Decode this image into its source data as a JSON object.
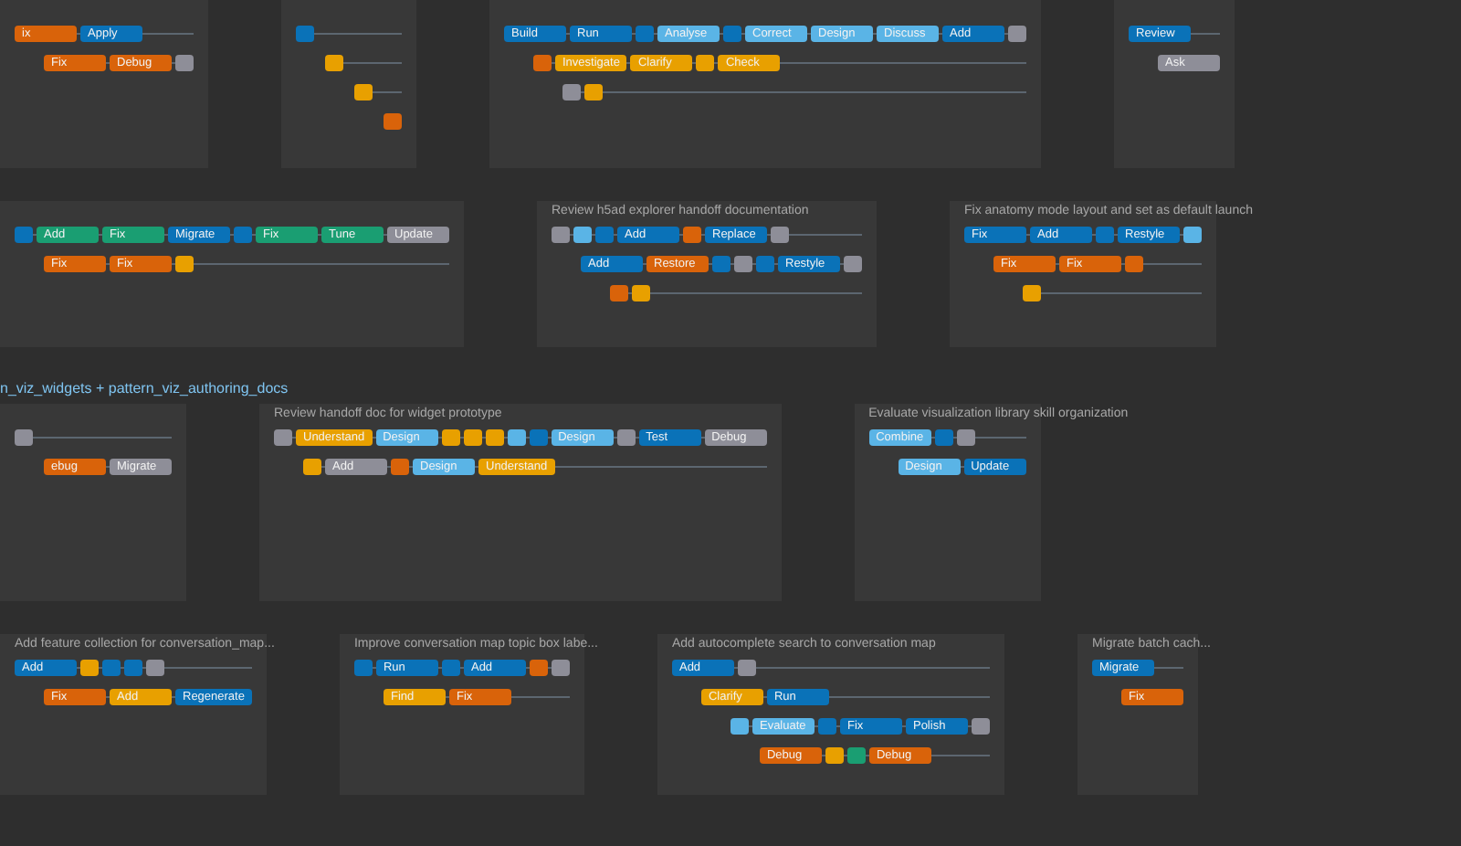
{
  "bands": [
    {
      "panels": [
        {
          "lanes": [
            {
              "nodes": [
                {
                  "label": "ix",
                  "color": "#d9630a"
                },
                {
                  "label": "Apply",
                  "color": "#0a72b8"
                }
              ]
            },
            {
              "nodes": [
                {
                  "label": "Fix",
                  "color": "#d9630a"
                },
                {
                  "label": "Debug",
                  "color": "#d9630a"
                },
                {
                  "color": "#8e8e98"
                }
              ]
            }
          ]
        },
        {
          "lanes": [
            {
              "nodes": [
                {
                  "color": "#0a72b8"
                }
              ]
            },
            {
              "nodes": [
                {
                  "color": "#e8a000"
                }
              ]
            },
            {
              "nodes": [
                {
                  "color": "#e8a000"
                }
              ]
            },
            {
              "nodes": [
                {
                  "color": "#d9630a"
                }
              ]
            }
          ]
        },
        {
          "lanes": [
            {
              "nodes": [
                {
                  "label": "Build",
                  "color": "#0a72b8"
                },
                {
                  "label": "Run",
                  "color": "#0a72b8"
                },
                {
                  "color": "#0a72b8"
                },
                {
                  "label": "Analyse",
                  "color": "#5ab4e6"
                },
                {
                  "color": "#0a72b8"
                },
                {
                  "label": "Correct",
                  "color": "#5ab4e6"
                },
                {
                  "label": "Design",
                  "color": "#5ab4e6"
                },
                {
                  "label": "Discuss",
                  "color": "#5ab4e6"
                },
                {
                  "label": "Add",
                  "color": "#0a72b8"
                },
                {
                  "color": "#8e8e98"
                }
              ]
            },
            {
              "nodes": [
                {
                  "color": "#d9630a"
                },
                {
                  "label": "Investigate",
                  "color": "#e8a000"
                },
                {
                  "label": "Clarify",
                  "color": "#e8a000"
                },
                {
                  "color": "#e8a000"
                },
                {
                  "label": "Check",
                  "color": "#e8a000"
                }
              ]
            },
            {
              "nodes": [
                {
                  "color": "#8e8e98"
                },
                {
                  "color": "#e8a000"
                }
              ]
            }
          ]
        },
        {
          "lanes": [
            {
              "nodes": [
                {
                  "label": "Review",
                  "color": "#0a72b8"
                }
              ]
            },
            {
              "nodes": [
                {
                  "label": "Ask",
                  "color": "#8e8e98"
                }
              ]
            }
          ]
        }
      ]
    },
    {
      "panels": [
        {
          "lanes": [
            {
              "nodes": [
                {
                  "color": "#0a72b8"
                },
                {
                  "label": "Add",
                  "color": "#1a9e72"
                },
                {
                  "label": "Fix",
                  "color": "#1a9e72"
                },
                {
                  "label": "Migrate",
                  "color": "#0a72b8"
                },
                {
                  "color": "#0a72b8"
                },
                {
                  "label": "Fix",
                  "color": "#1a9e72"
                },
                {
                  "label": "Tune",
                  "color": "#1a9e72"
                },
                {
                  "label": "Update",
                  "color": "#8e8e98"
                }
              ]
            },
            {
              "nodes": [
                {
                  "label": "Fix",
                  "color": "#d9630a"
                },
                {
                  "label": "Fix",
                  "color": "#d9630a"
                },
                {
                  "color": "#e8a000"
                }
              ]
            }
          ]
        },
        {
          "title": "Review h5ad explorer handoff documentation",
          "lanes": [
            {
              "nodes": [
                {
                  "color": "#8e8e98"
                },
                {
                  "color": "#5ab4e6"
                },
                {
                  "color": "#0a72b8"
                },
                {
                  "label": "Add",
                  "color": "#0a72b8"
                },
                {
                  "color": "#d9630a"
                },
                {
                  "label": "Replace",
                  "color": "#0a72b8"
                },
                {
                  "color": "#8e8e98"
                }
              ]
            },
            {
              "nodes": [
                {
                  "label": "Add",
                  "color": "#0a72b8"
                },
                {
                  "label": "Restore",
                  "color": "#d9630a"
                },
                {
                  "color": "#0a72b8"
                },
                {
                  "color": "#8e8e98"
                },
                {
                  "color": "#0a72b8"
                },
                {
                  "label": "Restyle",
                  "color": "#0a72b8"
                },
                {
                  "color": "#8e8e98"
                }
              ]
            },
            {
              "nodes": [
                {
                  "color": "#d9630a"
                },
                {
                  "color": "#e8a000"
                }
              ]
            }
          ]
        },
        {
          "title": "Fix anatomy mode layout and set as default launch",
          "lanes": [
            {
              "nodes": [
                {
                  "label": "Fix",
                  "color": "#0a72b8"
                },
                {
                  "label": "Add",
                  "color": "#0a72b8"
                },
                {
                  "color": "#0a72b8"
                },
                {
                  "label": "Restyle",
                  "color": "#0a72b8"
                },
                {
                  "color": "#5ab4e6"
                }
              ]
            },
            {
              "nodes": [
                {
                  "label": "Fix",
                  "color": "#d9630a"
                },
                {
                  "label": "Fix",
                  "color": "#d9630a"
                },
                {
                  "color": "#d9630a"
                }
              ]
            },
            {
              "nodes": [
                {
                  "color": "#e8a000"
                }
              ]
            }
          ]
        }
      ]
    },
    {
      "heading": "n_viz_widgets + pattern_viz_authoring_docs",
      "panels": [
        {
          "lanes": [
            {
              "nodes": [
                {
                  "color": "#8e8e98"
                }
              ]
            },
            {
              "nodes": [
                {
                  "label": "ebug",
                  "color": "#d9630a"
                },
                {
                  "label": "Migrate",
                  "color": "#8e8e98"
                }
              ]
            }
          ]
        },
        {
          "title": "Review handoff doc for widget prototype",
          "lanes": [
            {
              "nodes": [
                {
                  "color": "#8e8e98"
                },
                {
                  "label": "Understand",
                  "color": "#e8a000"
                },
                {
                  "label": "Design",
                  "color": "#5ab4e6"
                },
                {
                  "color": "#e8a000"
                },
                {
                  "color": "#e8a000"
                },
                {
                  "color": "#e8a000"
                },
                {
                  "color": "#5ab4e6"
                },
                {
                  "color": "#0a72b8"
                },
                {
                  "label": "Design",
                  "color": "#5ab4e6"
                },
                {
                  "color": "#8e8e98"
                },
                {
                  "label": "Test",
                  "color": "#0a72b8"
                },
                {
                  "label": "Debug",
                  "color": "#8e8e98"
                }
              ]
            },
            {
              "nodes": [
                {
                  "color": "#e8a000"
                },
                {
                  "label": "Add",
                  "color": "#8e8e98"
                },
                {
                  "color": "#d9630a"
                },
                {
                  "label": "Design",
                  "color": "#5ab4e6"
                },
                {
                  "label": "Understand",
                  "color": "#e8a000"
                }
              ]
            }
          ]
        },
        {
          "title": "Evaluate visualization library skill organization",
          "lanes": [
            {
              "nodes": [
                {
                  "label": "Combine",
                  "color": "#5ab4e6"
                },
                {
                  "color": "#0a72b8"
                },
                {
                  "color": "#8e8e98"
                }
              ]
            },
            {
              "nodes": [
                {
                  "label": "Design",
                  "color": "#5ab4e6"
                },
                {
                  "label": "Update",
                  "color": "#0a72b8"
                }
              ]
            }
          ]
        }
      ]
    },
    {
      "panels": [
        {
          "title": "Add feature collection for conversation_map...",
          "lanes": [
            {
              "nodes": [
                {
                  "label": "Add",
                  "color": "#0a72b8"
                },
                {
                  "color": "#e8a000"
                },
                {
                  "color": "#0a72b8"
                },
                {
                  "color": "#0a72b8"
                },
                {
                  "color": "#8e8e98"
                }
              ]
            },
            {
              "nodes": [
                {
                  "label": "Fix",
                  "color": "#d9630a"
                },
                {
                  "label": "Add",
                  "color": "#e8a000"
                },
                {
                  "label": "Regenerate",
                  "color": "#0a72b8"
                }
              ]
            }
          ]
        },
        {
          "title": "Improve conversation map topic box labe...",
          "lanes": [
            {
              "nodes": [
                {
                  "color": "#0a72b8"
                },
                {
                  "label": "Run",
                  "color": "#0a72b8"
                },
                {
                  "color": "#0a72b8"
                },
                {
                  "label": "Add",
                  "color": "#0a72b8"
                },
                {
                  "color": "#d9630a"
                },
                {
                  "color": "#8e8e98"
                }
              ]
            },
            {
              "nodes": [
                {
                  "label": "Find",
                  "color": "#e8a000"
                },
                {
                  "label": "Fix",
                  "color": "#d9630a"
                }
              ]
            }
          ]
        },
        {
          "title": "Add autocomplete search to conversation map",
          "lanes": [
            {
              "nodes": [
                {
                  "label": "Add",
                  "color": "#0a72b8"
                },
                {
                  "color": "#8e8e98"
                }
              ]
            },
            {
              "nodes": [
                {
                  "label": "Clarify",
                  "color": "#e8a000"
                },
                {
                  "label": "Run",
                  "color": "#0a72b8"
                }
              ]
            },
            {
              "nodes": [
                {
                  "color": "#5ab4e6"
                },
                {
                  "label": "Evaluate",
                  "color": "#5ab4e6"
                },
                {
                  "color": "#0a72b8"
                },
                {
                  "label": "Fix",
                  "color": "#0a72b8"
                },
                {
                  "label": "Polish",
                  "color": "#0a72b8"
                },
                {
                  "color": "#8e8e98"
                }
              ]
            },
            {
              "nodes": [
                {
                  "label": "Debug",
                  "color": "#d9630a"
                },
                {
                  "color": "#e8a000"
                },
                {
                  "color": "#1a9e72"
                },
                {
                  "label": "Debug",
                  "color": "#d9630a"
                }
              ]
            }
          ]
        },
        {
          "title": "Migrate batch cach...",
          "lanes": [
            {
              "nodes": [
                {
                  "label": "Migrate",
                  "color": "#0a72b8"
                }
              ]
            },
            {
              "nodes": [
                {
                  "label": "Fix",
                  "color": "#d9630a"
                }
              ]
            }
          ]
        }
      ]
    }
  ]
}
